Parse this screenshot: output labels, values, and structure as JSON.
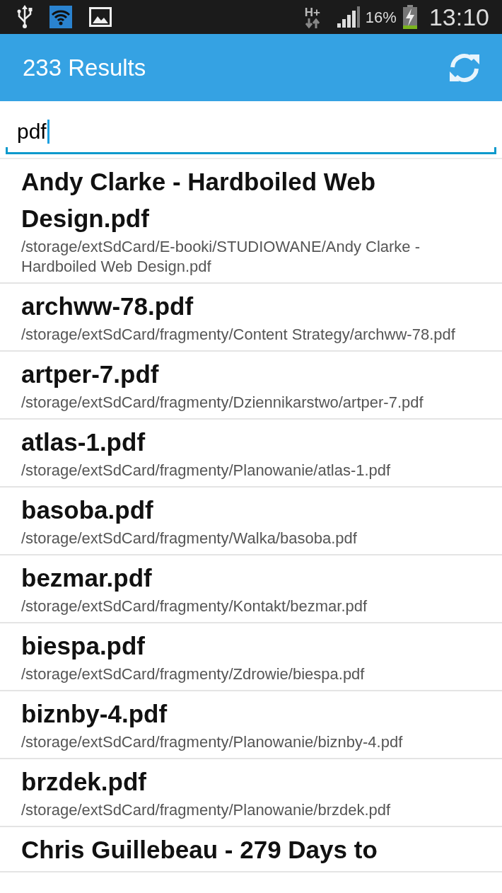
{
  "status_bar": {
    "network": "H+",
    "battery": "16%",
    "time": "13:10"
  },
  "app_bar": {
    "title": "233 Results"
  },
  "search": {
    "value": "pdf"
  },
  "results": [
    {
      "name": "Andy Clarke - Hardboiled Web Design.pdf",
      "path": "/storage/extSdCard/E-booki/STUDIOWANE/Andy Clarke - Hardboiled Web Design.pdf"
    },
    {
      "name": "archww-78.pdf",
      "path": "/storage/extSdCard/fragmenty/Content Strategy/archww-78.pdf"
    },
    {
      "name": "artper-7.pdf",
      "path": "/storage/extSdCard/fragmenty/Dziennikarstwo/artper-7.pdf"
    },
    {
      "name": "atlas-1.pdf",
      "path": "/storage/extSdCard/fragmenty/Planowanie/atlas-1.pdf"
    },
    {
      "name": "basoba.pdf",
      "path": "/storage/extSdCard/fragmenty/Walka/basoba.pdf"
    },
    {
      "name": "bezmar.pdf",
      "path": "/storage/extSdCard/fragmenty/Kontakt/bezmar.pdf"
    },
    {
      "name": "biespa.pdf",
      "path": "/storage/extSdCard/fragmenty/Zdrowie/biespa.pdf"
    },
    {
      "name": "biznby-4.pdf",
      "path": "/storage/extSdCard/fragmenty/Planowanie/biznby-4.pdf"
    },
    {
      "name": "brzdek.pdf",
      "path": "/storage/extSdCard/fragmenty/Planowanie/brzdek.pdf"
    },
    {
      "name": "Chris Guillebeau - 279 Days to"
    }
  ]
}
